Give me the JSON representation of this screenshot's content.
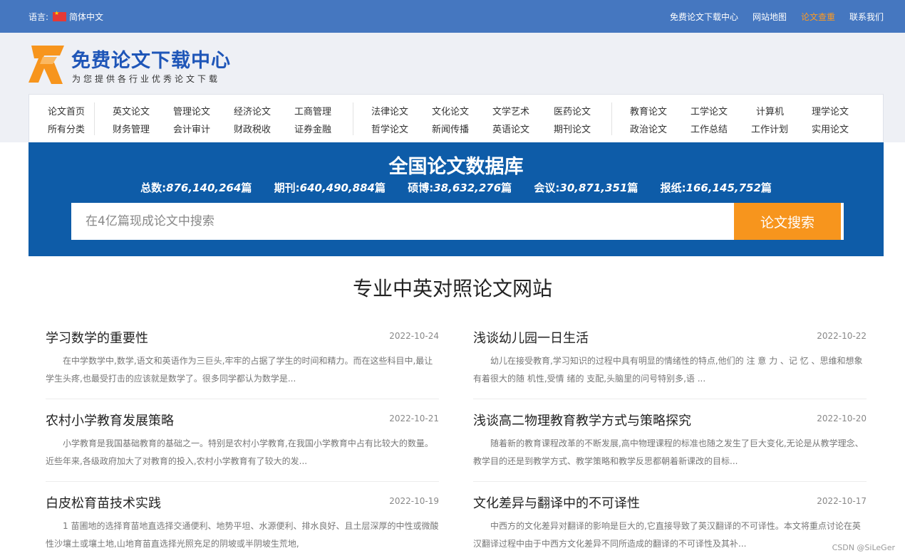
{
  "topbar": {
    "lang_label": "语言:",
    "lang_value": "简体中文",
    "links": [
      "免费论文下载中心",
      "网站地图",
      "论文查重",
      "联系我们"
    ]
  },
  "logo": {
    "title": "免费论文下载中心",
    "subtitle": "为您提供各行业优秀论文下载",
    "colors": {
      "mark": "#f7951d",
      "title": "#1f56b8"
    }
  },
  "nav": {
    "group1": [
      [
        "论文首页",
        "所有分类"
      ]
    ],
    "group2": [
      [
        "英文论文",
        "财务管理"
      ],
      [
        "管理论文",
        "会计审计"
      ],
      [
        "经济论文",
        "财政税收"
      ],
      [
        "工商管理",
        "证券金融"
      ]
    ],
    "group3": [
      [
        "法律论文",
        "哲学论文"
      ],
      [
        "文化论文",
        "新闻传播"
      ],
      [
        "文学艺术",
        "英语论文"
      ],
      [
        "医药论文",
        "期刊论文"
      ]
    ],
    "group4": [
      [
        "教育论文",
        "政治论文"
      ],
      [
        "工学论文",
        "工作总结"
      ],
      [
        "计算机",
        "工作计划"
      ],
      [
        "理学论文",
        "实用论文"
      ]
    ]
  },
  "database": {
    "title": "全国论文数据库",
    "stats": [
      {
        "label": "总数:",
        "value": "876,140,264",
        "unit": "篇"
      },
      {
        "label": "期刊:",
        "value": "640,490,884",
        "unit": "篇"
      },
      {
        "label": "硕博:",
        "value": "38,632,276",
        "unit": "篇"
      },
      {
        "label": "会议:",
        "value": "30,871,351",
        "unit": "篇"
      },
      {
        "label": "报纸:",
        "value": "166,145,752",
        "unit": "篇"
      }
    ]
  },
  "search": {
    "placeholder": "在4亿篇现成论文中搜索",
    "button": "论文搜索"
  },
  "section": {
    "title": "专业中英对照论文网站"
  },
  "articles": [
    {
      "title": "学习数学的重要性",
      "date": "2022-10-24",
      "summary": "在中学数学中,数学,语文和英语作为三巨头,牢牢的占据了学生的时间和精力。而在这些科目中,最让学生头疼,也最受打击的应该就是数学了。很多同学都认为数学是..."
    },
    {
      "title": "浅谈幼儿园一日生活",
      "date": "2022-10-22",
      "summary": "幼儿在接受教育,学习知识的过程中具有明显的情绪性的特点,他们的 注 意 力 、记 忆 、思维和想象有着很大的随 机性,受情 绪的 支配,头脑里的问号特别多,语 ..."
    },
    {
      "title": "农村小学教育发展策略",
      "date": "2022-10-21",
      "summary": "小学教育是我国基础教育的基础之一。特别是农村小学教育,在我国小学教育中占有比较大的数量。近些年来,各级政府加大了对教育的投入,农村小学教育有了较大的发..."
    },
    {
      "title": "浅谈高二物理教育教学方式与策略探究",
      "date": "2022-10-20",
      "summary": "随着新的教育课程改革的不断发展,高中物理课程的标准也随之发生了巨大变化,无论是从教学理念、教学目的还是到教学方式、教学策略和教学反思都朝着新课改的目标..."
    },
    {
      "title": "白皮松育苗技术实践",
      "date": "2022-10-19",
      "summary": "1 苗圃地的选择育苗地直选择交通便利、地势平坦、水源便利、排水良好、且土层深厚的中性或微酸性沙壤土或壤土地,山地育苗直选择光照充足的阴坡或半阴坡生荒地,"
    },
    {
      "title": "文化差异与翻译中的不可译性",
      "date": "2022-10-17",
      "summary": "中西方的文化差异对翻译的影响是巨大的,它直接导致了英汉翻译的不可译性。本文将重点讨论在英汉翻译过程中由于中西方文化差异不同所造成的翻译的不可译性及其补..."
    }
  ],
  "watermark": "CSDN @SiLeGer"
}
